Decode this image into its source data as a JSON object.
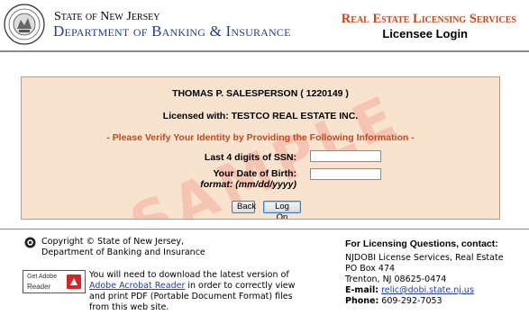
{
  "header": {
    "state_line": "State of New Jersey",
    "department_line": "Department of Banking & Insurance",
    "service_title": "Real Estate Licensing Services",
    "service_subtitle": "Licensee Login"
  },
  "panel": {
    "watermark": "SAMPLE",
    "licensee_name": "THOMAS P. SALESPERSON ( 1220149 )",
    "licensed_with": "Licensed with: TESTCO REAL ESTATE INC.",
    "verify_prompt": "- Please Verify Your Identity by Providing the Following Information -",
    "ssn_label": "Last 4 digits of SSN:",
    "ssn_value": "",
    "dob_label": "Your Date of Birth:",
    "dob_format": "format: (mm/dd/yyyy)",
    "dob_value": "",
    "back_button": "Back",
    "logon_button": "Log On"
  },
  "footer": {
    "copyright_line1": "Copyright © State of New Jersey,",
    "copyright_line2": "Department of Banking and Insurance",
    "adobe_badge_get": "Get Adobe",
    "adobe_badge_reader": "Reader",
    "pdf_prefix": "You will need to download the latest version of ",
    "pdf_link": "Adobe Acrobat Reader",
    "pdf_suffix": " in order to correctly view and print PDF (Portable Document Format) files from this web site.",
    "contact_heading": "For Licensing Questions, contact:",
    "contact_org": "NJDOBI License Services, Real Estate",
    "contact_po": "PO Box 474",
    "contact_city": "Trenton, NJ 08625-0474",
    "email_label": "E-mail:",
    "email_value": "relic@dobi.state.nj.us",
    "phone_label": "Phone:",
    "phone_value": "609-292-7053"
  },
  "colors": {
    "department_blue": "#1f3f8a",
    "service_orange": "#c8461e",
    "panel_bg": "#f8e3cf",
    "watermark": "#f08b82",
    "link_blue": "#1d3fa8"
  },
  "icons": {
    "seal": "nj-state-seal-icon",
    "copyright": "copyright-info-icon",
    "adobe": "adobe-reader-icon"
  }
}
